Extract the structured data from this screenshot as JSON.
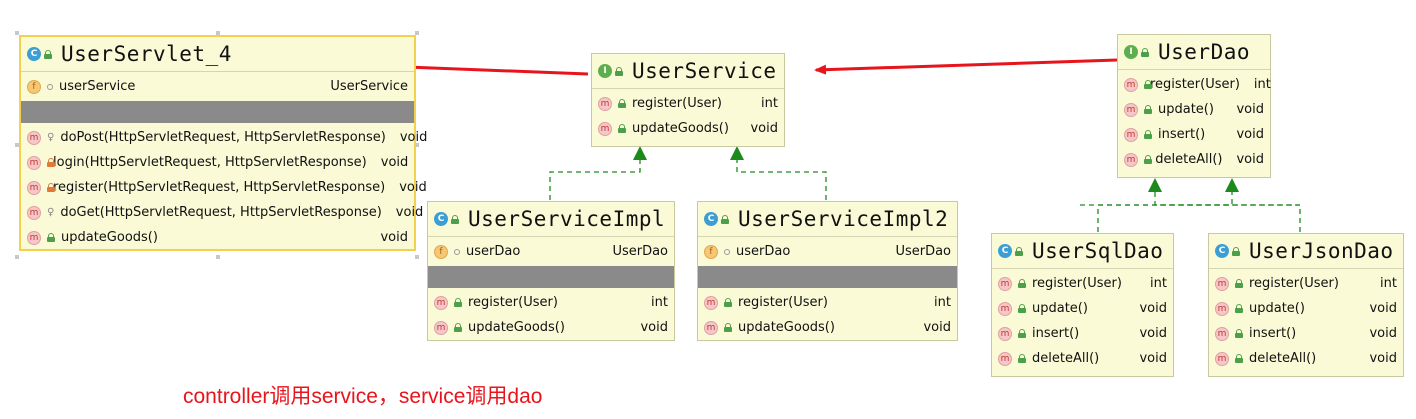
{
  "classes": {
    "servlet": {
      "kind": "C",
      "name": "UserServlet_4",
      "fields": [
        {
          "name": "userService",
          "type": "UserService"
        }
      ],
      "methods": [
        {
          "name": "doPost(HttpServletRequest, HttpServletResponse)",
          "type": "void"
        },
        {
          "name": "login(HttpServletRequest, HttpServletResponse)",
          "type": "void"
        },
        {
          "name": "register(HttpServletRequest, HttpServletResponse)",
          "type": "void"
        },
        {
          "name": "doGet(HttpServletRequest, HttpServletResponse)",
          "type": "void"
        },
        {
          "name": "updateGoods()",
          "type": "void"
        }
      ]
    },
    "userService": {
      "kind": "I",
      "name": "UserService",
      "methods": [
        {
          "name": "register(User)",
          "type": "int"
        },
        {
          "name": "updateGoods()",
          "type": "void"
        }
      ]
    },
    "userDao": {
      "kind": "I",
      "name": "UserDao",
      "methods": [
        {
          "name": "register(User)",
          "type": "int"
        },
        {
          "name": "update()",
          "type": "void"
        },
        {
          "name": "insert()",
          "type": "void"
        },
        {
          "name": "deleteAll()",
          "type": "void"
        }
      ]
    },
    "serviceImpl": {
      "kind": "C",
      "name": "UserServiceImpl",
      "fields": [
        {
          "name": "userDao",
          "type": "UserDao"
        }
      ],
      "methods": [
        {
          "name": "register(User)",
          "type": "int"
        },
        {
          "name": "updateGoods()",
          "type": "void"
        }
      ]
    },
    "serviceImpl2": {
      "kind": "C",
      "name": "UserServiceImpl2",
      "fields": [
        {
          "name": "userDao",
          "type": "UserDao"
        }
      ],
      "methods": [
        {
          "name": "register(User)",
          "type": "int"
        },
        {
          "name": "updateGoods()",
          "type": "void"
        }
      ]
    },
    "sqlDao": {
      "kind": "C",
      "name": "UserSqlDao",
      "methods": [
        {
          "name": "register(User)",
          "type": "int"
        },
        {
          "name": "update()",
          "type": "void"
        },
        {
          "name": "insert()",
          "type": "void"
        },
        {
          "name": "deleteAll()",
          "type": "void"
        }
      ]
    },
    "jsonDao": {
      "kind": "C",
      "name": "UserJsonDao",
      "methods": [
        {
          "name": "register(User)",
          "type": "int"
        },
        {
          "name": "update()",
          "type": "void"
        },
        {
          "name": "insert()",
          "type": "void"
        },
        {
          "name": "deleteAll()",
          "type": "void"
        }
      ]
    }
  },
  "annotation": "controller调用service，service调用dao",
  "colors": {
    "annotation": "#e8141c",
    "dependency_arrow": "#e8141c",
    "realization_arrow": "#1e8a1e",
    "class_fill": "#fafad6",
    "selected_border": "#f2d14d"
  }
}
